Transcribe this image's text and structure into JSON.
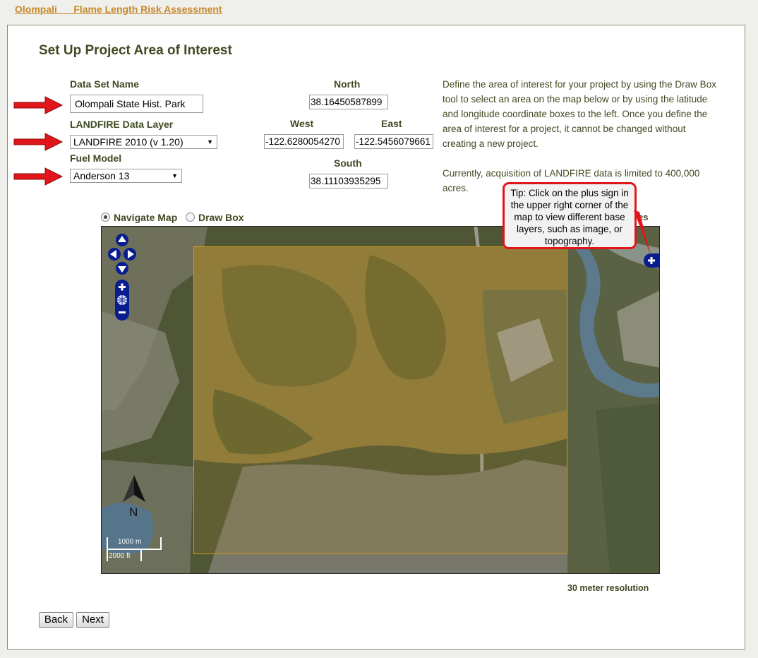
{
  "breadcrumb": "Olompali __ Flame Length Risk Assessment",
  "page_title": "Set Up Project Area of Interest",
  "form": {
    "dataset_name_label": "Data Set Name",
    "dataset_name_value": "Olompali State Hist. Park",
    "landfire_label": "LANDFIRE Data Layer",
    "landfire_value": "LANDFIRE 2010 (v 1.20)",
    "fuel_model_label": "Fuel Model",
    "fuel_model_value": "Anderson 13"
  },
  "coords": {
    "north_label": "North",
    "north_value": "38.16450587899",
    "west_label": "West",
    "west_value": "-122.6280054270",
    "east_label": "East",
    "east_value": "-122.5456079661",
    "south_label": "South",
    "south_value": "38.11103935295"
  },
  "description": {
    "para1": "Define the area of interest for your project by using the Draw Box tool to select an area on the map below or by using the latitude and longitude coordinate boxes to the left. Once you define the area of interest for a project, it cannot be changed without creating a new project.",
    "para2": "Currently, acquisition of LANDFIRE data is limited to 400,000 acres."
  },
  "map_mode": {
    "navigate_label": "Navigate Map",
    "draw_label": "Draw Box",
    "selected": "Navigate Map",
    "obscured_tail": "es"
  },
  "tip": "Tip: Click on the plus sign in the upper right corner of the map to view different base layers, such as image, or topography.",
  "map": {
    "north_letter": "N",
    "scale_metric": "1000 m",
    "scale_imperial": "2000 ft"
  },
  "resolution": "30 meter resolution",
  "buttons": {
    "back": "Back",
    "next": "Next"
  },
  "colors": {
    "accent": "#c8892d",
    "heading": "#3f4a22",
    "callout_border": "#e0161b",
    "map_controls": "#0a1d8f",
    "draw_box": "#d49a1b"
  }
}
